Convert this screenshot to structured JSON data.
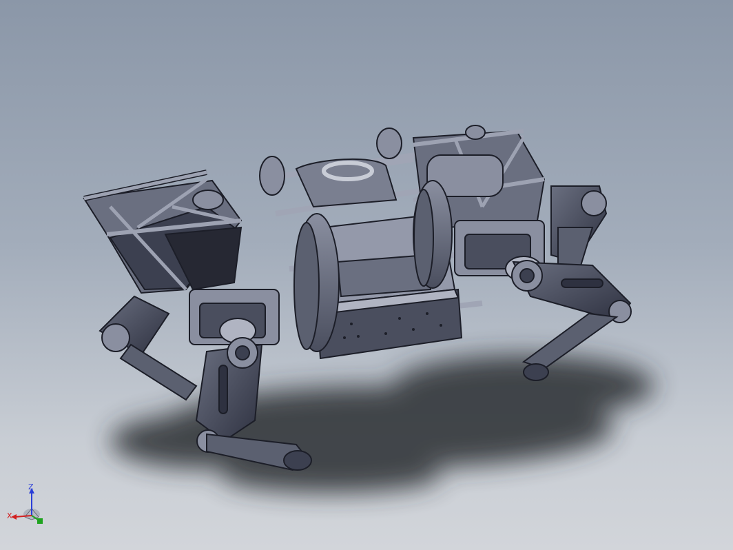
{
  "viewport": {
    "background_top": "#8b97a8",
    "background_bottom": "#d2d5da",
    "model_name": "",
    "model_description": ""
  },
  "triad": {
    "x_label": "X",
    "y_label": "Y",
    "z_label": "Z",
    "x_color": "#d21f1f",
    "y_color": "#1fa31f",
    "z_color": "#2a3ed8"
  },
  "colors": {
    "part_fill": "#5b6070",
    "part_light": "#8a8fa0",
    "part_dark": "#2e3140",
    "edge": "#1c1e28",
    "shadow": "#2b2d33"
  }
}
